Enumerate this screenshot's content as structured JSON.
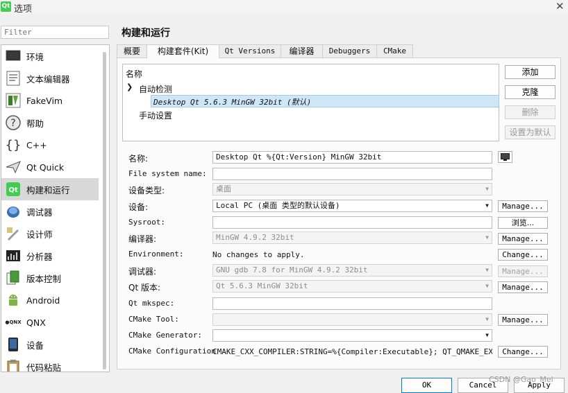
{
  "window": {
    "title": "选项",
    "logo_text": "Qt"
  },
  "filter": {
    "placeholder": "Filter"
  },
  "sidebar": {
    "items": [
      {
        "label": "环境",
        "icon": "monitor-icon"
      },
      {
        "label": "文本编辑器",
        "icon": "text-editor-icon"
      },
      {
        "label": "FakeVim",
        "icon": "fakevim-icon"
      },
      {
        "label": "帮助",
        "icon": "help-icon"
      },
      {
        "label": "C++",
        "icon": "braces-icon"
      },
      {
        "label": "Qt Quick",
        "icon": "paper-plane-icon"
      },
      {
        "label": "构建和运行",
        "icon": "qt-build-icon"
      },
      {
        "label": "调试器",
        "icon": "debugger-icon"
      },
      {
        "label": "设计师",
        "icon": "designer-icon"
      },
      {
        "label": "分析器",
        "icon": "analyzer-icon"
      },
      {
        "label": "版本控制",
        "icon": "version-control-icon"
      },
      {
        "label": "Android",
        "icon": "android-icon"
      },
      {
        "label": "QNX",
        "icon": "qnx-icon"
      },
      {
        "label": "设备",
        "icon": "device-icon"
      },
      {
        "label": "代码粘贴",
        "icon": "code-paste-icon"
      }
    ],
    "selected": "构建和运行"
  },
  "page_title": "构建和运行",
  "tabs": [
    {
      "label": "概要"
    },
    {
      "label": "构建套件(Kit)"
    },
    {
      "label": "Qt Versions"
    },
    {
      "label": "编译器"
    },
    {
      "label": "Debuggers"
    },
    {
      "label": "CMake"
    }
  ],
  "active_tab": "构建套件(Kit)",
  "kit_tree": {
    "header": "名称",
    "auto_group": "自动检测",
    "selected_kit": "Desktop Qt 5.6.3 MinGW 32bit (默认)",
    "manual_group": "手动设置"
  },
  "kit_buttons": {
    "add": "添加",
    "clone": "克隆",
    "delete": "删除",
    "set_default": "设置为默认"
  },
  "form": {
    "name": {
      "label": "名称:",
      "value": "Desktop Qt %{Qt:Version} MinGW 32bit"
    },
    "filesystem": {
      "label": "File system name:",
      "value": ""
    },
    "device_type": {
      "label": "设备类型:",
      "value": "桌面"
    },
    "device": {
      "label": "设备:",
      "value": "Local PC (桌面 类型的默认设备)",
      "button": "Manage..."
    },
    "sysroot": {
      "label": "Sysroot:",
      "value": "",
      "button": "浏览..."
    },
    "compiler": {
      "label": "编译器:",
      "value": "MinGW 4.9.2 32bit",
      "button": "Manage..."
    },
    "environment": {
      "label": "Environment:",
      "value": "No changes to apply.",
      "button": "Change..."
    },
    "debugger": {
      "label": "调试器:",
      "value": "GNU gdb 7.8 for MinGW 4.9.2 32bit",
      "button": "Manage..."
    },
    "qt_version": {
      "label": "Qt 版本:",
      "value": "Qt 5.6.3 MinGW 32bit",
      "button": "Manage..."
    },
    "qt_mkspec": {
      "label": "Qt mkspec:",
      "value": ""
    },
    "cmake_tool": {
      "label": "CMake Tool:",
      "value": "",
      "button": "Manage..."
    },
    "cmake_generator": {
      "label": "CMake Generator:",
      "value": ""
    },
    "cmake_config": {
      "label": "CMake Configuration",
      "value": "CMAKE_CXX_COMPILER:STRING=%{Compiler:Executable}; QT_QMAKE_EXECUT…",
      "button": "Change..."
    }
  },
  "bottom_buttons": {
    "ok": "OK",
    "cancel": "Cancel",
    "apply": "Apply"
  },
  "watermark": "CSDN @Gao_Mel",
  "colors": {
    "selection": "#cfe6f7",
    "accent": "#0078d7",
    "qt_green": "#41cd52"
  }
}
